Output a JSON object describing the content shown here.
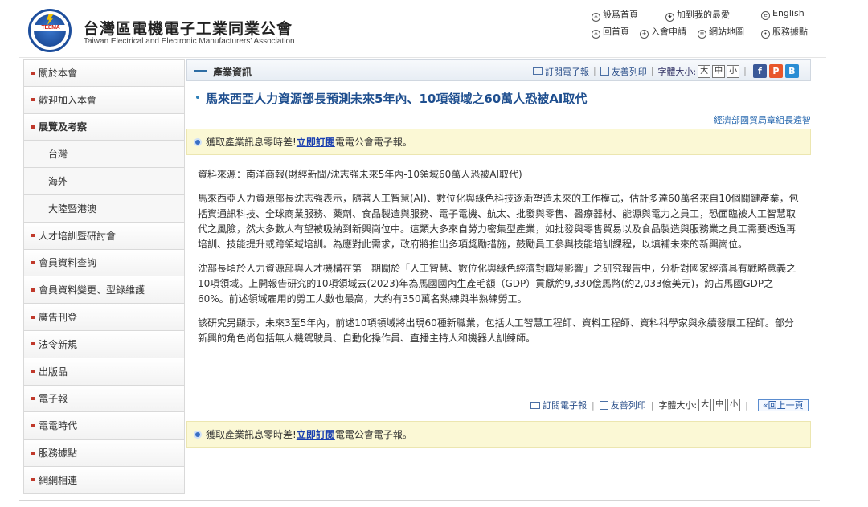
{
  "header": {
    "org_name_zh": "台灣區電機電子工業同業公會",
    "org_name_en": "Taiwan Electrical and Electronic Manufacturers' Association",
    "logo_text": "TEEMA",
    "links": {
      "set_home": "設爲首頁",
      "bookmark": "加到我的最愛",
      "english": "English",
      "home": "回首頁",
      "join": "入會申請",
      "sitemap": "網站地圖",
      "service": "服務據點"
    }
  },
  "sidebar": {
    "items": [
      {
        "label": "關於本會"
      },
      {
        "label": "歡迎加入本會"
      },
      {
        "label": "展覽及考察"
      },
      {
        "label": "台灣"
      },
      {
        "label": "海外"
      },
      {
        "label": "大陸暨港澳"
      },
      {
        "label": "人才培訓暨研討會"
      },
      {
        "label": "會員資料查詢"
      },
      {
        "label": "會員資料變更、型錄維護"
      },
      {
        "label": "廣告刊登"
      },
      {
        "label": "法令新規"
      },
      {
        "label": "出版品"
      },
      {
        "label": "電子報"
      },
      {
        "label": "電電時代"
      },
      {
        "label": "服務據點"
      },
      {
        "label": "網網相連"
      }
    ]
  },
  "main": {
    "section_title": "產業資訊",
    "tools": {
      "subscribe": "訂閱電子報",
      "print": "友善列印",
      "font_size_label": "字體大小:",
      "size_large": "大",
      "size_medium": "中",
      "size_small": "小",
      "back_to_top": "«回上一頁"
    },
    "social": {
      "facebook": "f",
      "plurk": "P",
      "blogger": "B"
    },
    "article_title": "馬來西亞人力資源部長預測未來5年內、10項領域之60萬人恐被AI取代",
    "source_org": "經濟部國貿局章組長遠智",
    "subscribe_bar": {
      "text_before": "獲取產業訊息零時差!",
      "link": "立即訂閱",
      "text_after": "電電公會電子報。"
    },
    "paragraphs": [
      "資料來源：南洋商報(財經新聞/沈志強未來5年內-10領域60萬人恐被AI取代)",
      "馬來西亞人力資源部長沈志強表示，隨著人工智慧(AI)、數位化與綠色科技逐漸塑造未來的工作模式，估計多達60萬名來自10個關鍵產業，包括資通訊科技、全球商業服務、藥劑、食品製造與服務、電子電機、航太、批發與零售、醫療器材、能源與電力之員工，恐面臨被人工智慧取代之風險，然大多數人有望被吸納到新興崗位中。這類大多來自勞力密集型產業，如批發與零售貿易以及食品製造與服務業之員工需要透過再培訓、技能提升或跨領域培訓。為應對此需求，政府將推出多項獎勵措施，鼓勵員工參與技能培訓課程，以填補未來的新興崗位。",
      "沈部長頃於人力資源部與人才機構在第一期關於「人工智慧、數位化與綠色經濟對職場影響」之研究報告中，分析對國家經濟具有戰略意義之10項領域。上開報告研究的10項領域去(2023)年為馬國國內生產毛額（GDP）貢獻約9,330億馬幣(約2,033億美元)，約占馬國GDP之60%。前述領域雇用的勞工人數也最高，大約有350萬名熟練與半熟練勞工。",
      "該研究另顯示，未來3至5年內，前述10項領域將出現60種新職業，包括人工智慧工程師、資料工程師、資料科學家與永續發展工程師。部分新興的角色尚包括無人機駕駛員、自動化操作員、直播主持人和機器人訓練師。"
    ]
  },
  "colors": {
    "title_blue": "#1f4f8f",
    "bullet_red": "#c0392b",
    "notice_bg": "#fbf8d5",
    "link_blue": "#1a3fb0"
  }
}
